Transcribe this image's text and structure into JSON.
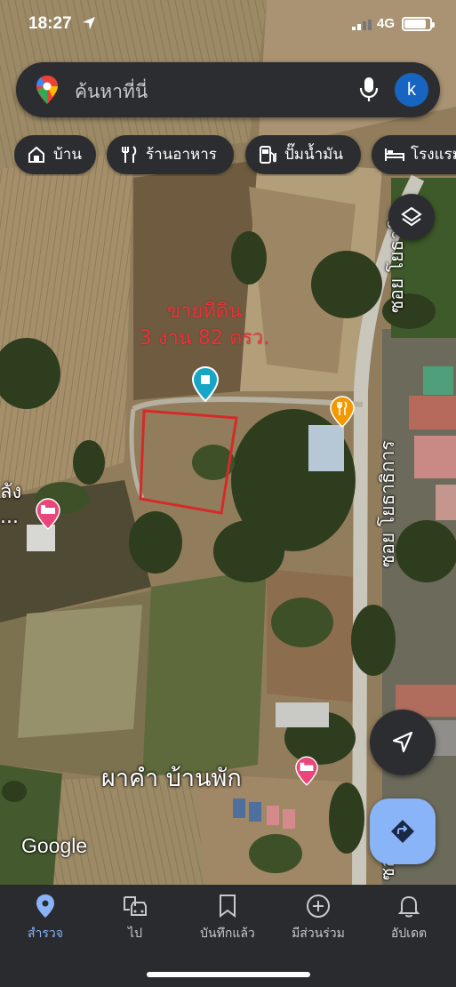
{
  "status_bar": {
    "time": "18:27",
    "network": "4G",
    "battery_level": 0.85
  },
  "search": {
    "placeholder": "ค้นหาที่นี่",
    "avatar_letter": "k"
  },
  "chips": [
    {
      "label": "บ้าน",
      "icon": "home-icon"
    },
    {
      "label": "ร้านอาหาร",
      "icon": "restaurant-icon"
    },
    {
      "label": "ปั๊มน้ำมัน",
      "icon": "gas-station-icon"
    },
    {
      "label": "โรงแรม",
      "icon": "hotel-icon"
    }
  ],
  "map": {
    "annotation_line1": "ขายที่ดิน",
    "annotation_line2": "3 งาน 82 ตรว.",
    "road_label": "ซอย โยธาธิการ",
    "road_label_top": "ซอย โยธาธิ",
    "road_label_bottom": "ซอย",
    "place_name": "ผาคำ บ้านพัก",
    "left_place_partial": "ลัง",
    "left_place_partial2": "...",
    "pin_color": "#18a6c7",
    "restaurant_pin_color": "#f29900",
    "hotel_pin_color": "#e9467a",
    "plot_outline_color": "#d52a2a"
  },
  "google_logo": "Google",
  "bottom_nav": [
    {
      "label": "สำรวจ",
      "icon": "explore-pin-icon",
      "active": true
    },
    {
      "label": "ไป",
      "icon": "commute-car-icon",
      "active": false
    },
    {
      "label": "บันทึกแล้ว",
      "icon": "bookmark-icon",
      "active": false
    },
    {
      "label": "มีส่วนร่วม",
      "icon": "contribute-plus-icon",
      "active": false
    },
    {
      "label": "อัปเดต",
      "icon": "bell-icon",
      "active": false
    }
  ],
  "colors": {
    "accent": "#8ab4f8",
    "surface": "#2c2d31",
    "nav_bg": "#2a2b2f"
  }
}
